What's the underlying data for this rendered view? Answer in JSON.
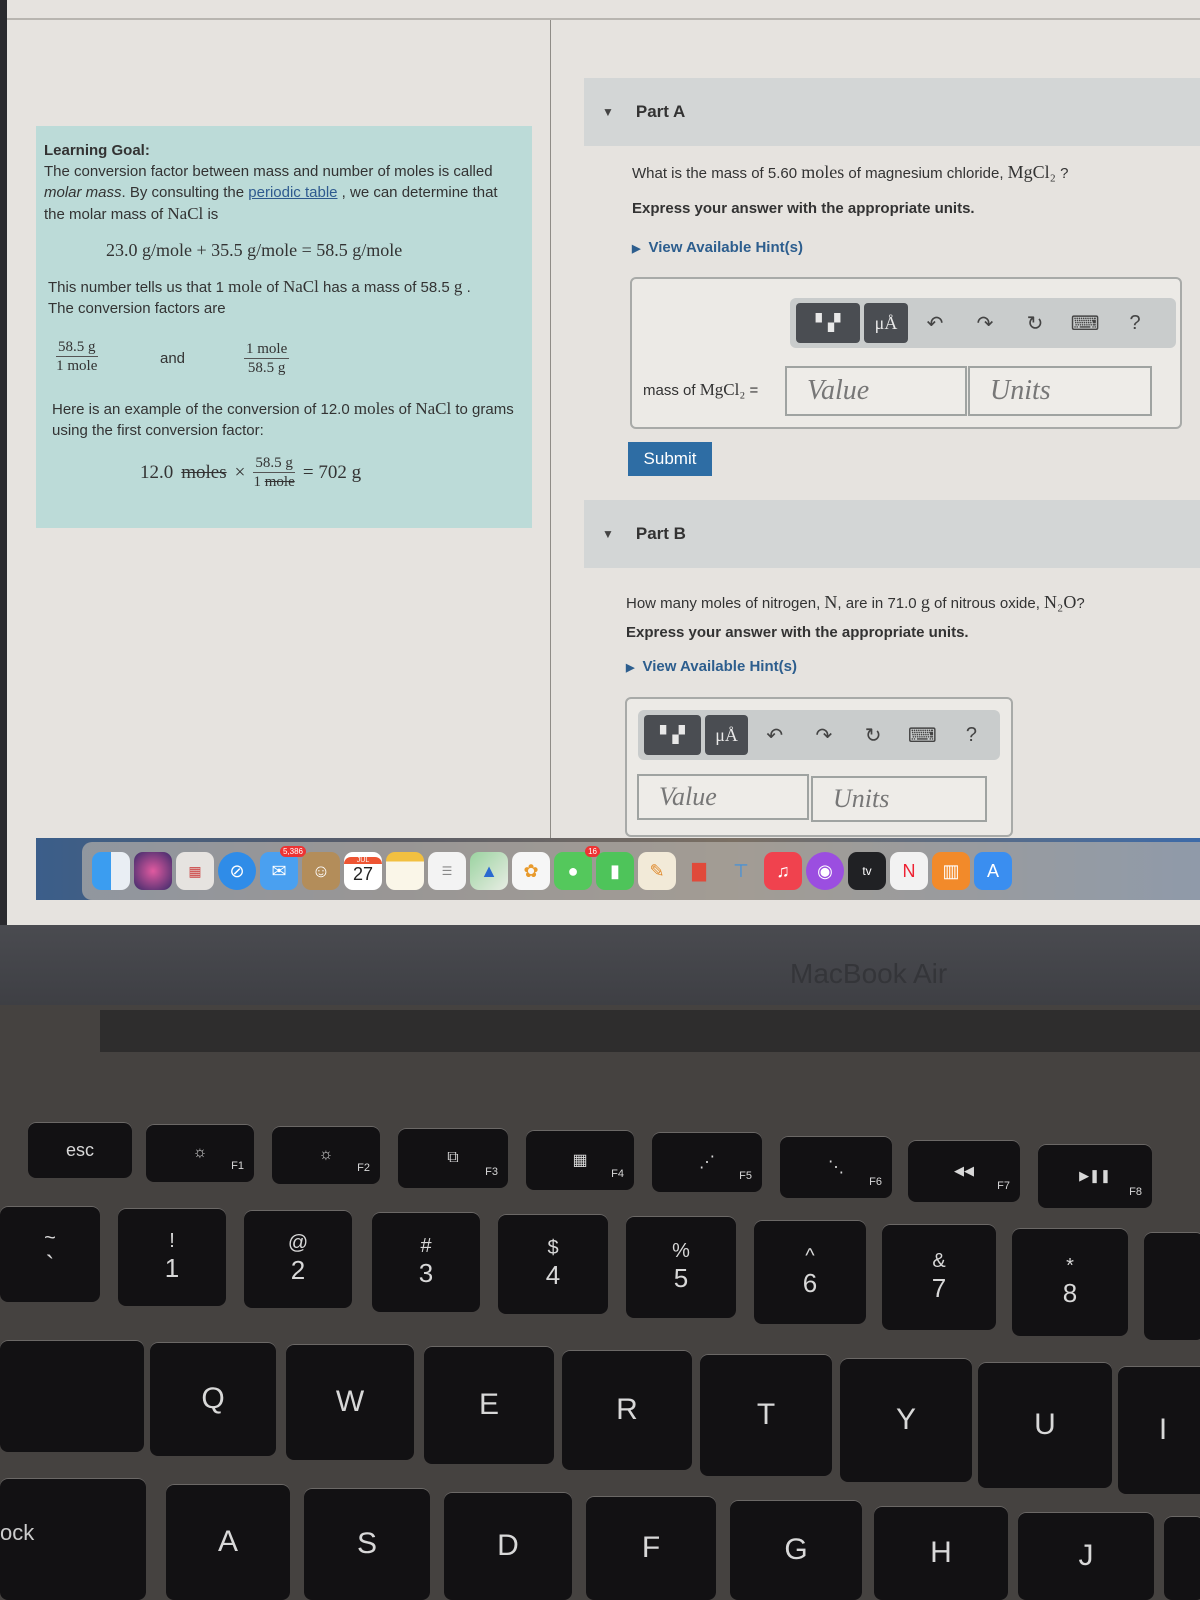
{
  "learning_goal": {
    "title": "Learning Goal:",
    "p1_before": "The conversion factor between mass and number of moles is called ",
    "p1_italic": "molar mass",
    "p1_mid": ". By consulting the ",
    "p1_link": "periodic table",
    "p1_after": " , we can determine that the molar mass of ",
    "p1_formula": "NaCl",
    "p1_end": " is",
    "equation": "23.0 g/mole + 35.5 g/mole = 58.5 g/mole",
    "p2_a": "This number tells us that 1 ",
    "p2_mole": "mole",
    "p2_b": " of ",
    "p2_formula": "NaCl",
    "p2_c": " has a mass of 58.5 ",
    "p2_g": "g",
    "p2_d": " .",
    "p2_line2": "The conversion factors are",
    "factor1": {
      "num": "58.5 g",
      "den": "1 mole"
    },
    "and": "and",
    "factor2": {
      "num": "1 mole",
      "den": "58.5 g"
    },
    "p3_a": "Here is an example of the conversion of 12.0 ",
    "p3_moles": "moles",
    "p3_b": " of ",
    "p3_formula": "NaCl",
    "p3_c": " to grams using the first conversion factor:",
    "example": {
      "qty": "12.0",
      "unit_cancel": "moles",
      "times": "×",
      "num": "58.5 g",
      "den_qty": "1",
      "den_unit": "mole",
      "result": "= 702 g"
    }
  },
  "part_a": {
    "header": "Part A",
    "question_a": "What is the mass of 5.60 ",
    "question_moles": "moles",
    "question_b": " of magnesium chloride, ",
    "question_formula": "MgCl₂",
    "question_end": " ?",
    "express": "Express your answer with the appropriate units.",
    "hint": "View Available Hint(s)",
    "field_label_a": "mass of ",
    "field_label_formula": "MgCl₂",
    "field_label_b": " =",
    "value_placeholder": "Value",
    "units_placeholder": "Units",
    "submit": "Submit"
  },
  "part_b": {
    "header": "Part B",
    "question_a": "How many moles of nitrogen, ",
    "question_n": "N",
    "question_b": ", are in 71.0 ",
    "question_g": "g",
    "question_c": " of nitrous oxide, ",
    "question_formula": "N₂O",
    "question_end": "?",
    "express": "Express your answer with the appropriate units.",
    "hint": "View Available Hint(s)",
    "value_placeholder": "Value",
    "units_placeholder": "Units"
  },
  "toolbar": {
    "units_button": "μÅ",
    "undo": "↶",
    "redo": "↷",
    "reset": "↻",
    "keyboard": "⌨",
    "help": "?"
  },
  "dock": {
    "mail_badge": "5,386",
    "messages_badge": "16",
    "calendar_month": "JUL",
    "calendar_day": "27",
    "apps": [
      "Finder",
      "Siri",
      "Launchpad",
      "Safari",
      "Mail",
      "Contacts",
      "Calendar",
      "Notes",
      "Reminders",
      "Maps",
      "Photos",
      "Messages",
      "FaceTime",
      "Pages",
      "Numbers",
      "Keynote",
      "Music",
      "Podcasts",
      "TV",
      "News",
      "Books",
      "App Store"
    ]
  },
  "device": {
    "brand": "MacBook Air"
  },
  "keyboard": {
    "esc": "esc",
    "f1": "F1",
    "f2": "F2",
    "f3": "F3",
    "f4": "F4",
    "f5": "F5",
    "f6": "F6",
    "f7": "F7",
    "f8": "F8",
    "f1_icon": "☼",
    "f2_icon": "☼",
    "f3_icon": "⧉",
    "f4_icon": "▦",
    "f5_icon": "⋰",
    "f6_icon": "⋱",
    "f7_icon": "◀◀",
    "f8_icon": "▶❚❚",
    "tilde": "~",
    "backtick": "`",
    "num_keys": [
      {
        "sym": "!",
        "num": "1"
      },
      {
        "sym": "@",
        "num": "2"
      },
      {
        "sym": "#",
        "num": "3"
      },
      {
        "sym": "$",
        "num": "4"
      },
      {
        "sym": "%",
        "num": "5"
      },
      {
        "sym": "^",
        "num": "6"
      },
      {
        "sym": "&",
        "num": "7"
      },
      {
        "sym": "*",
        "num": "8"
      }
    ],
    "row_q": [
      "Q",
      "W",
      "E",
      "R",
      "T",
      "Y",
      "U",
      "I"
    ],
    "row_a": [
      "A",
      "S",
      "D",
      "F",
      "G",
      "H",
      "J"
    ],
    "caps_lock": "ock"
  }
}
